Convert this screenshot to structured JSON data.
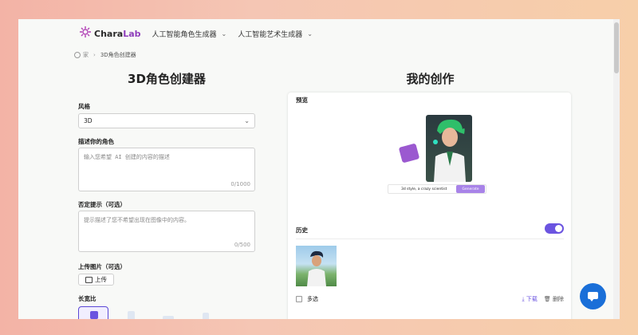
{
  "nav": {
    "logo_prefix": "Chara",
    "logo_suffix": "Lab",
    "items": [
      {
        "label": "人工智能角色生成器"
      },
      {
        "label": "人工智能艺术生成器"
      }
    ]
  },
  "breadcrumb": {
    "home": "家",
    "current": "3D角色创建器"
  },
  "left": {
    "title": "3D角色创建器",
    "style_label": "风格",
    "style_value": "3D",
    "describe_label": "描述你的角色",
    "describe_placeholder": "输入您希望 AI 创建的内容的描述",
    "describe_count": "0/1000",
    "negative_label": "否定提示（可选）",
    "negative_placeholder": "提示描述了您不希望出现在图像中的内容。",
    "negative_count": "0/500",
    "upload_label": "上传图片（可选）",
    "upload_button": "上传",
    "ratio_label": "长宽比"
  },
  "right": {
    "title": "我的创作",
    "preview_label": "预览",
    "preview_prompt": "3d style, a crazy scientist",
    "preview_generate": "Generate",
    "history_label": "历史",
    "history_toggle_on": true,
    "multi_select": "多选",
    "download": "下载",
    "delete": "删除"
  },
  "colors": {
    "accent": "#6b54e0",
    "chat": "#1a6fd8"
  },
  "icons": [
    "logo-icon",
    "chevron-down-icon",
    "home-icon",
    "image-icon",
    "download-icon",
    "trash-icon",
    "chat-icon"
  ]
}
